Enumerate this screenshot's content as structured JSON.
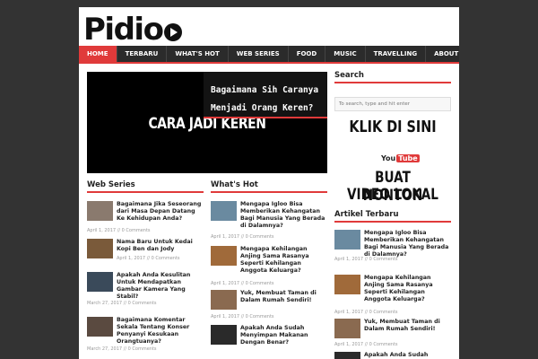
{
  "logo": {
    "text": "Pidio"
  },
  "nav": {
    "items": [
      "HOME",
      "TERBARU",
      "WHAT'S HOT",
      "WEB SERIES",
      "FOOD",
      "MUSIC",
      "TRAVELLING",
      "ABOUT"
    ],
    "active": "HOME"
  },
  "featured": {
    "video_text": "CARA JADI KEREN",
    "caption": "Bagaimana Sih Caranya Menjadi Orang Keren?"
  },
  "web_series": {
    "title": "Web Series",
    "posts": [
      {
        "title": "Bagaimana Jika Seseorang dari Masa Depan Datang Ke Kehidupan Anda?",
        "meta": "April 1, 2017 // 0 Comments"
      },
      {
        "title": "Nama Baru Untuk Kedai Kopi Ben dan Jody",
        "meta": "April 1, 2017 // 0 Comments"
      },
      {
        "title": "Apakah Anda Kesulitan Untuk Mendapatkan Gambar Kamera Yang Stabil?",
        "meta": "March 27, 2017 // 0 Comments"
      },
      {
        "title": "Bagaimana Komentar Sekala Tentang Konser Penyanyi Kesukaan Orangtuanya?",
        "meta": "March 27, 2017 // 0 Comments"
      }
    ]
  },
  "whats_hot": {
    "title": "What's Hot",
    "posts": [
      {
        "title": "Mengapa Igloo Bisa Memberikan Kehangatan Bagi Manusia Yang Berada di Dalamnya?",
        "meta": "April 1, 2017 // 0 Comments"
      },
      {
        "title": "Mengapa Kehilangan Anjing Sama Rasanya Seperti Kehilangan Anggota Keluarga?",
        "meta": "April 1, 2017 // 0 Comments"
      },
      {
        "title": "Yuk, Membuat Taman di Dalam Rumah Sendiri!",
        "meta": "April 1, 2017 // 0 Comments"
      },
      {
        "title": "Apakah Anda Sudah Menyimpan Makanan Dengan Benar?",
        "meta": "April 1, 2017 // 0 Comments"
      }
    ]
  },
  "sidebar": {
    "search_title": "Search",
    "search_placeholder": "To search, type and hit enter",
    "ad_line1": "KLIK DI SINI",
    "youtube_you": "You",
    "youtube_tube": "Tube",
    "ad_line2": "BUAT NONTON",
    "ad_line3": "VIDEO LOKAL",
    "terbaru_title": "Artikel Terbaru",
    "posts": [
      {
        "title": "Mengapa Igloo Bisa Memberikan Kehangatan Bagi Manusia Yang Berada di Dalamnya?",
        "meta": "April 1, 2017 // 0 Comments"
      },
      {
        "title": "Mengapa Kehilangan Anjing Sama Rasanya Seperti Kehilangan Anggota Keluarga?",
        "meta": "April 1, 2017 // 0 Comments"
      },
      {
        "title": "Yuk, Membuat Taman di Dalam Rumah Sendiri!",
        "meta": "April 1, 2017 // 0 Comments"
      },
      {
        "title": "Apakah Anda Sudah",
        "meta": ""
      }
    ]
  },
  "colors": {
    "accent": "#e03a3a",
    "nav_bg": "#2b2b2b",
    "page_bg": "#333333"
  }
}
